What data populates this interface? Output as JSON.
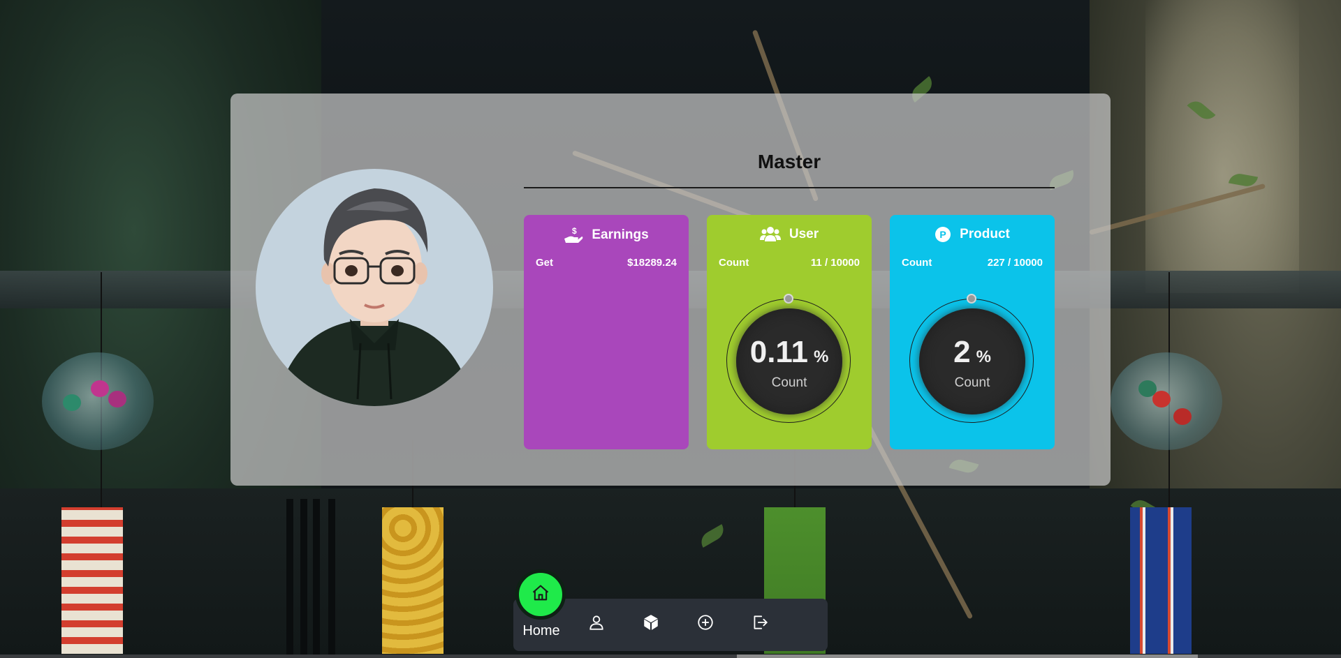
{
  "profile": {
    "name": "Master"
  },
  "stats": {
    "earnings": {
      "title": "Earnings",
      "icon": "hand-dollar-icon",
      "row_label": "Get",
      "row_value": "$18289.24",
      "color": "#a947bb"
    },
    "user": {
      "title": "User",
      "icon": "users-icon",
      "row_label": "Count",
      "row_value": "11 / 10000",
      "gauge_value": "0.11",
      "gauge_unit": "%",
      "gauge_label": "Count",
      "percent": 0.11,
      "color": "#9fcc2e"
    },
    "product": {
      "title": "Product",
      "icon": "product-p-icon",
      "row_label": "Count",
      "row_value": "227 / 10000",
      "gauge_value": "2",
      "gauge_unit": "%",
      "gauge_label": "Count",
      "percent": 2,
      "color": "#0bc3ea"
    }
  },
  "nav": {
    "active_label": "Home",
    "active_color": "#1fea4a",
    "items": [
      {
        "name": "home",
        "icon": "home-icon"
      },
      {
        "name": "profile",
        "icon": "user-icon"
      },
      {
        "name": "products",
        "icon": "cube-icon"
      },
      {
        "name": "add",
        "icon": "plus-circle-icon"
      },
      {
        "name": "logout",
        "icon": "logout-icon"
      }
    ]
  }
}
